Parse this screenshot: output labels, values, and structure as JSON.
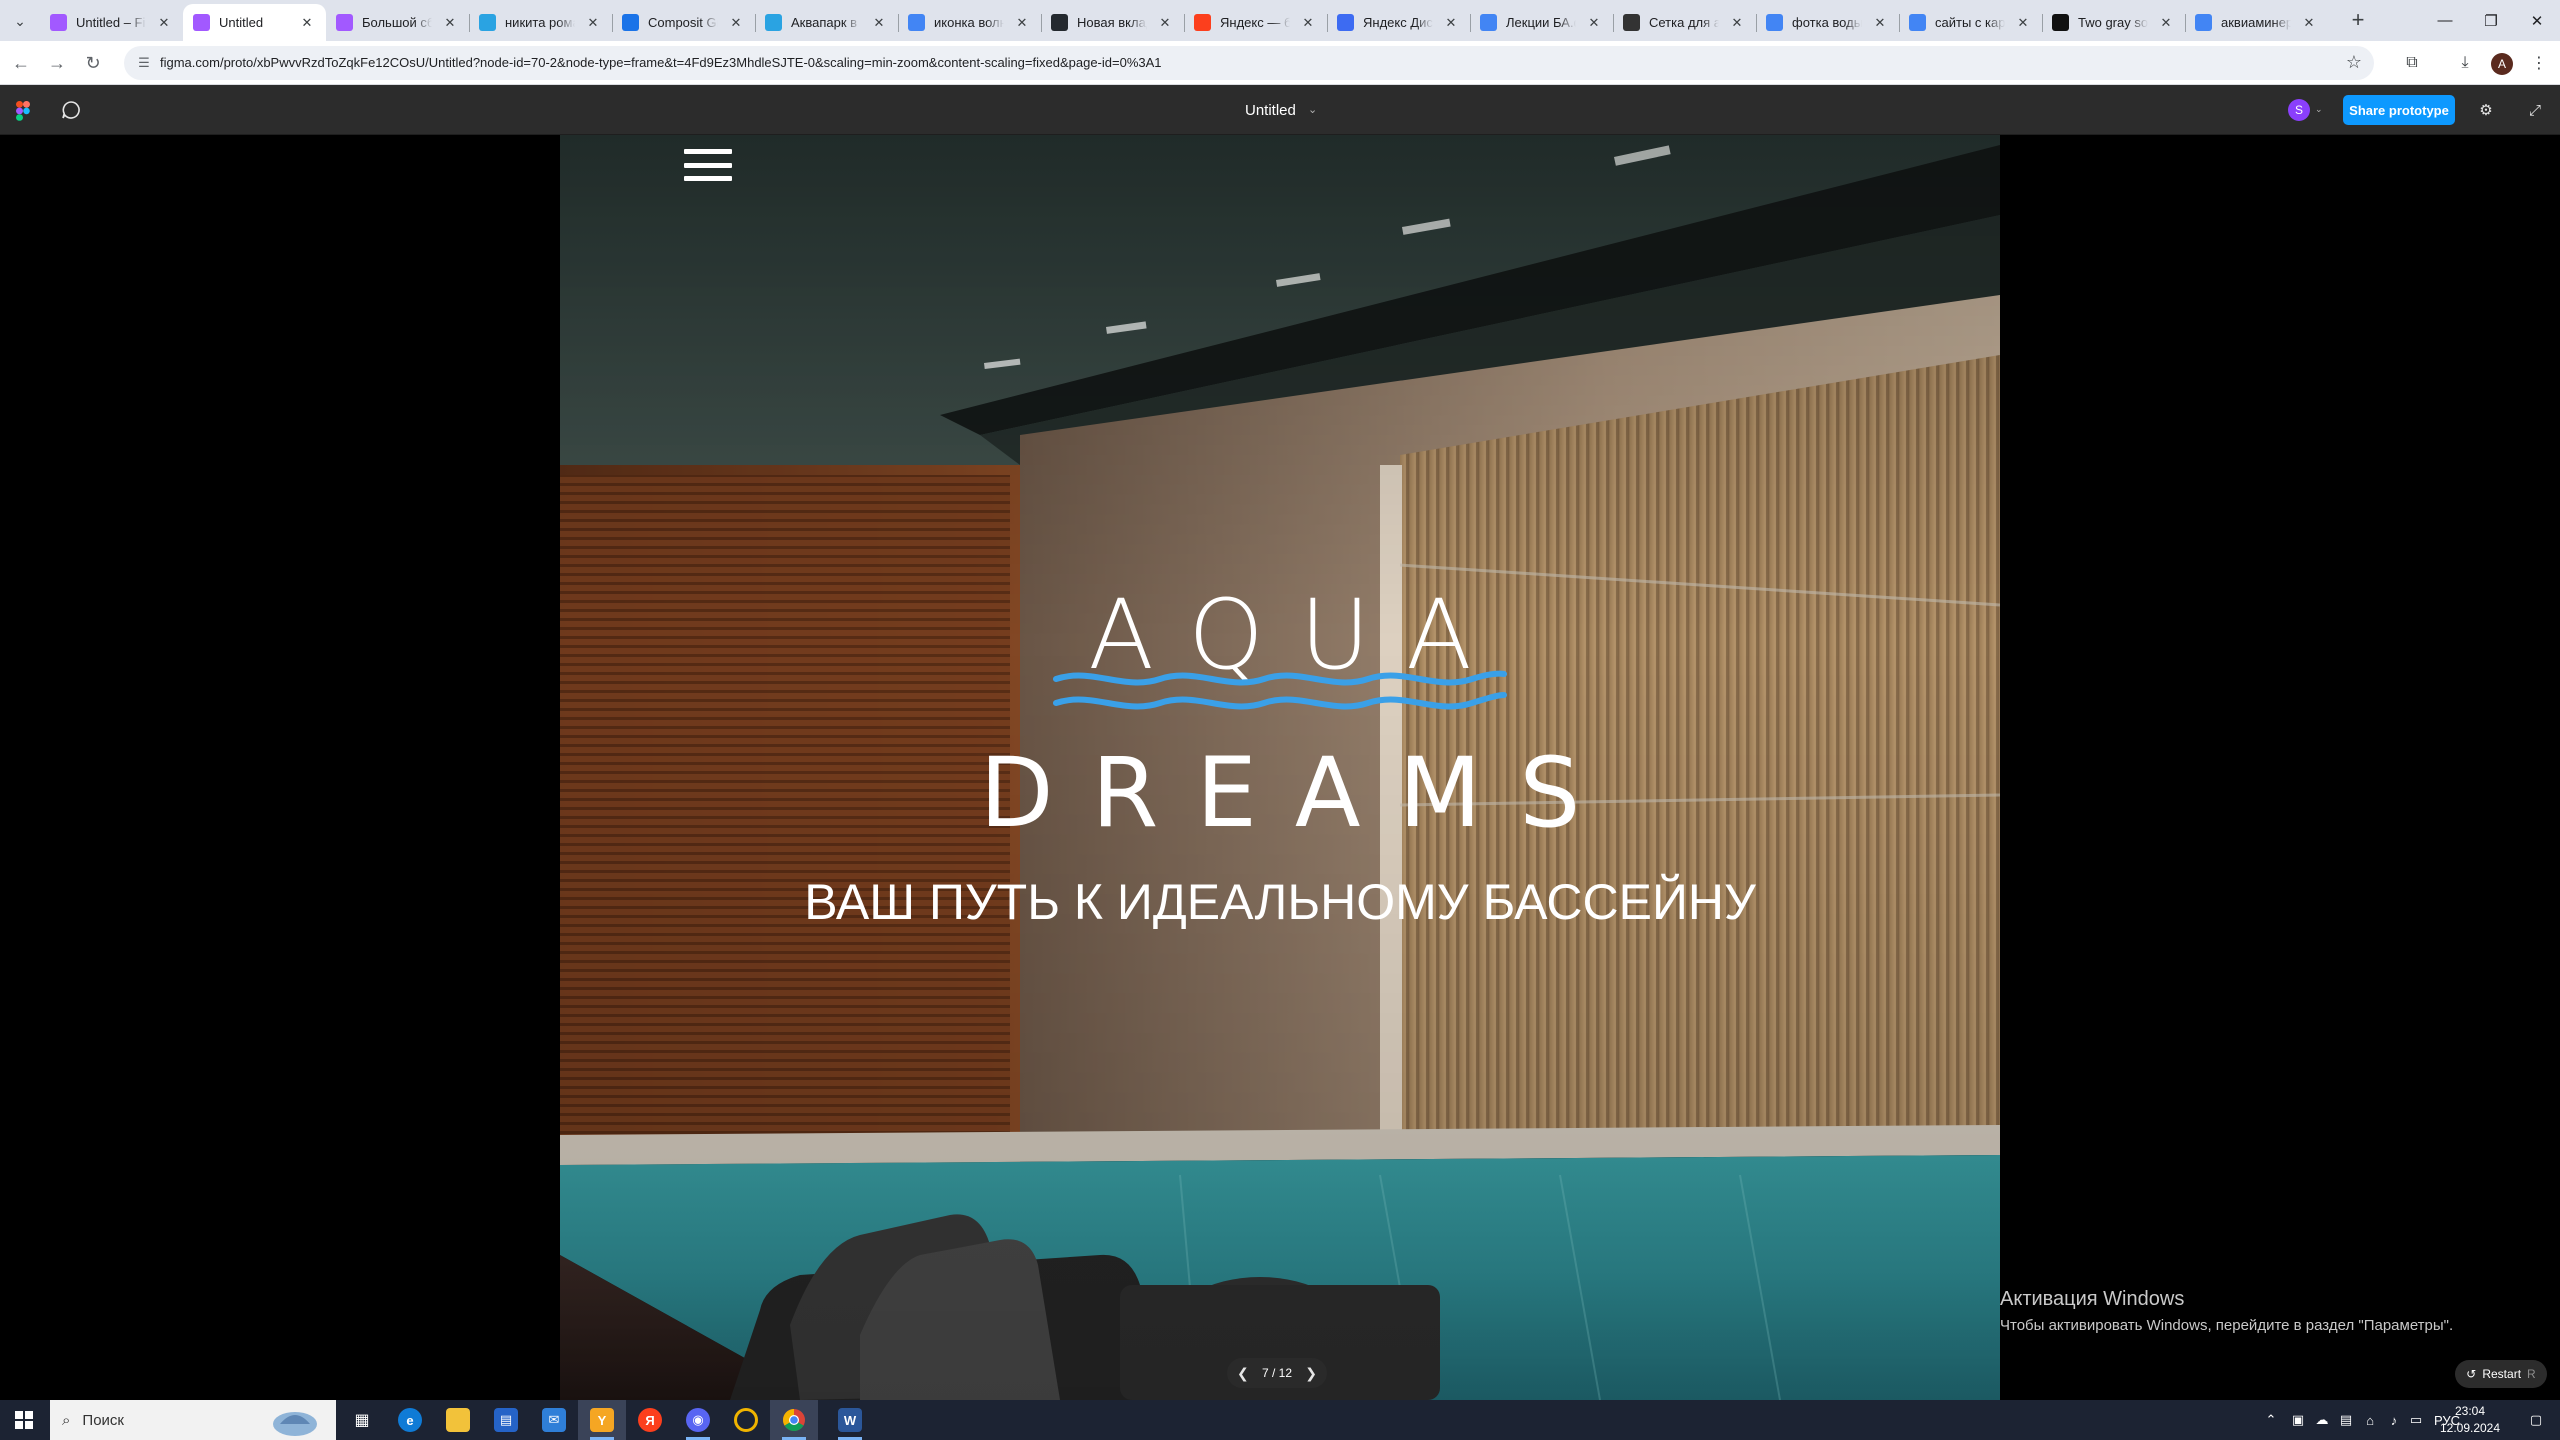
{
  "browser": {
    "tabs": [
      {
        "title": "Untitled – Figma",
        "favicon": "figma-icon",
        "color": "#a259ff"
      },
      {
        "title": "Untitled",
        "favicon": "figma-icon",
        "color": "#a259ff",
        "active": true
      },
      {
        "title": "Большой сборник",
        "favicon": "figma-icon",
        "color": "#a259ff"
      },
      {
        "title": "никита романов",
        "favicon": "telegram-icon",
        "color": "#2aa3e2"
      },
      {
        "title": "Composit Group",
        "favicon": "composit-icon",
        "color": "#1a73e8"
      },
      {
        "title": "Аквапарк в Москве",
        "favicon": "telegram-icon",
        "color": "#2aa3e2"
      },
      {
        "title": "иконка волны",
        "favicon": "google-icon",
        "color": "#4285f4"
      },
      {
        "title": "Новая вкладка",
        "favicon": "github-icon",
        "color": "#24292f"
      },
      {
        "title": "Яндекс — быстрый",
        "favicon": "yandex-icon",
        "color": "#fc3f1d"
      },
      {
        "title": "Яндекс Диск",
        "favicon": "yandex-disk-icon",
        "color": "#3d6bf2"
      },
      {
        "title": "Лекции БА.docx",
        "favicon": "docs-icon",
        "color": "#4285f4"
      },
      {
        "title": "Сетка для адаптива",
        "favicon": "doc-icon",
        "color": "#333333"
      },
      {
        "title": "фотка воды с",
        "favicon": "google-icon",
        "color": "#4285f4"
      },
      {
        "title": "сайты с картинками",
        "favicon": "google-icon",
        "color": "#4285f4"
      },
      {
        "title": "Two gray sofas",
        "favicon": "unsplash-icon",
        "color": "#111111"
      },
      {
        "title": "аквиаминерал",
        "favicon": "google-icon",
        "color": "#4285f4"
      }
    ],
    "new_tab_label": "+",
    "url": "figma.com/proto/xbPwvvRzdToZqkFe12COsU/Untitled?node-id=70-2&node-type=frame&t=4Fd9Ez3MhdleSJTE-0&scaling=min-zoom&content-scaling=fixed&page-id=0%3A1",
    "profile_initial": "A"
  },
  "figma": {
    "file_title": "Untitled",
    "avatar_initial": "S",
    "share_label": "Share prototype",
    "page_counter": "7 / 12",
    "restart_label": "Restart",
    "restart_shortcut": "R"
  },
  "prototype": {
    "logo_line1": "AQUA",
    "logo_line2": "DREAMS",
    "tagline": "ВАШ ПУТЬ К ИДЕАЛЬНОМУ БАССЕЙНУ",
    "wave_color": "#3aa0e8"
  },
  "windows": {
    "activation_title": "Активация Windows",
    "activation_text": "Чтобы активировать Windows, перейдите в раздел \"Параметры\".",
    "search_placeholder": "Поиск",
    "language": "РУС",
    "time": "23:04",
    "date": "12.09.2024"
  }
}
